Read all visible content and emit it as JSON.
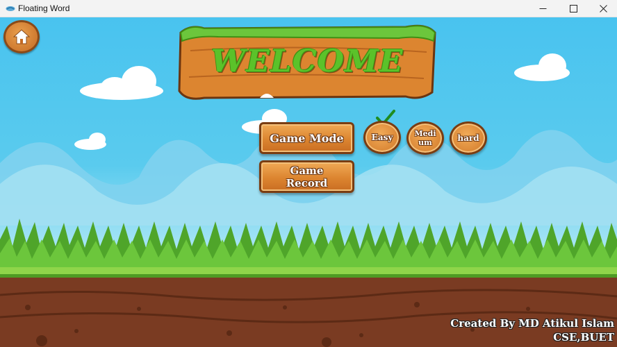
{
  "window": {
    "title": "Floating Word",
    "controls": {
      "minimize": "minimize-icon",
      "maximize": "maximize-icon",
      "close": "close-icon"
    }
  },
  "scene": {
    "home_button": {
      "icon": "home-icon"
    },
    "welcome_sign": "WELCOME",
    "buttons": {
      "game_mode": "Game Mode",
      "game_record": "Game\nRecord"
    },
    "difficulty": {
      "easy": "Easy",
      "medium": "Medi\num",
      "hard": "hard",
      "selected": "Easy",
      "selected_icon": "checkmark-icon"
    },
    "credit": {
      "line1": "Created By MD Atikul Islam",
      "line2": "CSE,BUET"
    }
  },
  "colors": {
    "sky": "#49c3ef",
    "grass": "#6cc63c",
    "soil": "#7a3b22",
    "wood": "#dc8530",
    "welcome_text": "#5bc22a"
  }
}
